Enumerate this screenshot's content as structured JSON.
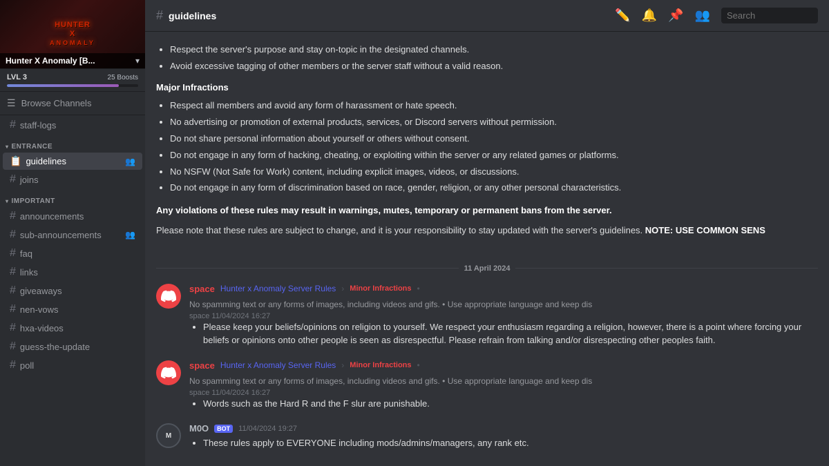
{
  "server": {
    "name": "Hunter X Anomaly [B...",
    "banner_text": "Hunter\nX\nAnomaly",
    "level": "LVL 3",
    "boosts": "25 Boosts",
    "boost_progress": 85
  },
  "sidebar": {
    "browse_channels": "Browse Channels",
    "channels": [
      {
        "id": "staff-logs",
        "name": "staff-logs",
        "hash": true,
        "separator": true
      }
    ],
    "categories": [
      {
        "name": "ENTRANCE",
        "channels": [
          {
            "id": "guidelines",
            "name": "guidelines",
            "active": true,
            "icon": "people"
          },
          {
            "id": "joins",
            "name": "joins",
            "active": false
          }
        ]
      },
      {
        "name": "IMPORTANT",
        "channels": [
          {
            "id": "announcements",
            "name": "announcements",
            "active": false
          },
          {
            "id": "sub-announcements",
            "name": "sub-announcements",
            "active": false,
            "icon": "people"
          },
          {
            "id": "faq",
            "name": "faq",
            "active": false
          },
          {
            "id": "links",
            "name": "links",
            "active": false
          },
          {
            "id": "giveaways",
            "name": "giveaways",
            "active": false
          },
          {
            "id": "nen-vows",
            "name": "nen-vows",
            "active": false
          },
          {
            "id": "hxa-videos",
            "name": "hxa-videos",
            "active": false
          },
          {
            "id": "guess-the-update",
            "name": "guess-the-update",
            "active": false
          },
          {
            "id": "poll",
            "name": "poll",
            "active": false
          }
        ]
      }
    ]
  },
  "channel": {
    "name": "guidelines"
  },
  "toolbar": {
    "search_placeholder": "Search"
  },
  "rules": {
    "bullets_top": [
      "Respect the server's purpose and stay on-topic in the designated channels.",
      "Avoid excessive tagging of other members or the server staff without a valid reason."
    ],
    "major_heading": "Major Infractions",
    "major_bullets": [
      "Respect all members and avoid any form of harassment or hate speech.",
      "No advertising or promotion of external products, services, or Discord servers without permission.",
      "Do not share personal information about yourself or others without consent.",
      "Do not engage in any form of hacking, cheating, or exploiting within the server or any related games or platforms.",
      "No NSFW (Not Safe for Work) content, including explicit images, videos, or discussions.",
      "Do not engage in any form of discrimination based on race, gender, religion, or any other personal characteristics."
    ],
    "warning": "Any violations of these rules may result in warnings, mutes, temporary or permanent bans from the server.",
    "note": "Please note that these rules are subject to change, and it is your responsibility to stay updated with the server's guidelines.",
    "note_emphasis": "NOTE: USE COMMON SENS"
  },
  "divider": {
    "date": "11 April 2024"
  },
  "messages": [
    {
      "id": "msg1",
      "author": "space",
      "author_color": "red",
      "timestamp": "11/04/2024 16:27",
      "channel_ref": "Hunter x Anomaly Server Rules",
      "tag": "Minor Infractions",
      "preview": "• No spamming text or any forms of images, including videos and gifs.  •  Use appropriate language and keep dis",
      "body": "Please keep your beliefs/opinions on religion to yourself. We respect your enthusiasm regarding a religion, however, there is a point where forcing your beliefs or opinions onto other people is seen as disrespectful. Please refrain from talking and/or disrespecting other peoples faith.",
      "avatar": "discord"
    },
    {
      "id": "msg2",
      "author": "space",
      "author_color": "red",
      "timestamp": "11/04/2024 16:27",
      "channel_ref": "Hunter x Anomaly Server Rules",
      "tag": "Minor Infractions",
      "preview": "• No spamming text or any forms of images, including videos and gifs.  •  Use appropriate language and keep dis",
      "body": "Words such as the Hard R and the F slur are punishable.",
      "avatar": "discord"
    },
    {
      "id": "msg3",
      "author": "M0O",
      "author_color": "gray",
      "timestamp": "11/04/2024 19:27",
      "body": "These rules apply to EVERYONE including mods/admins/managers, any rank etc.",
      "avatar": "moo",
      "has_bot_badge": true
    }
  ]
}
